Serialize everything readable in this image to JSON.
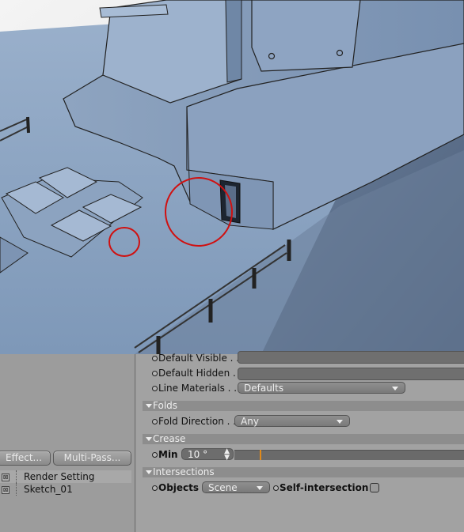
{
  "left_panel": {
    "buttons": {
      "effect": "Effect...",
      "multipass": "Multi-Pass..."
    },
    "render_list": [
      {
        "label": "Render Setting"
      },
      {
        "label": "Sketch_01"
      }
    ]
  },
  "properties": {
    "default_visible_label": "Default Visible . .",
    "default_hidden_label": "Default Hidden . .",
    "line_materials_label": "Line Materials . .",
    "line_materials_value": "Defaults",
    "folds_section": "Folds",
    "fold_direction_label": "Fold Direction . .",
    "fold_direction_value": "Any",
    "crease_section": "Crease",
    "min_label": "Min",
    "min_value": "10 °",
    "min_slider_fraction": 0.11,
    "intersections_section": "Intersections",
    "objects_label": "Objects",
    "objects_value": "Scene",
    "self_intersection_label": "Self-intersection",
    "self_intersection_checked": false
  },
  "colors": {
    "panel": "#a2a2a2",
    "slider_marker": "#e08a1a",
    "annotation": "#d01010",
    "model_blue": "#8fa8c7"
  }
}
